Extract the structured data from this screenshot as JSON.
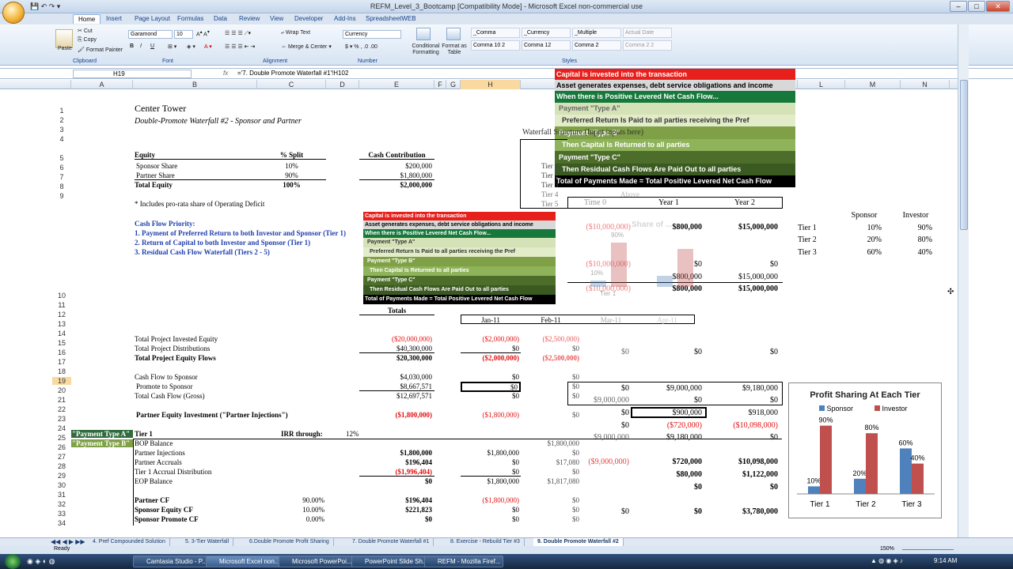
{
  "app": {
    "title": "REFM_Level_3_Bootcamp [Compatibility Mode] - Microsoft Excel non-commercial use"
  },
  "ribbon": {
    "tabs": [
      "Home",
      "Insert",
      "Page Layout",
      "Formulas",
      "Data",
      "Review",
      "View",
      "Developer",
      "Add-Ins",
      "SpreadsheetWEB"
    ],
    "clipboard": {
      "paste": "Paste",
      "cut": "Cut",
      "copy": "Copy",
      "format_painter": "Format Painter",
      "label": "Clipboard"
    },
    "font": {
      "name": "Garamond",
      "size": "10",
      "label": "Font"
    },
    "alignment": {
      "wrap": "Wrap Text",
      "merge": "Merge & Center",
      "label": "Alignment"
    },
    "number": {
      "format": "Currency",
      "label": "Number"
    },
    "styles": {
      "conditional": "Conditional Formatting",
      "table": "Format as Table",
      "boxes": [
        "_Comma",
        "_Currency",
        "_Multiple",
        "Actual Date",
        "Comma 10 2",
        "Comma 12",
        "Comma 2",
        "Comma 2 2"
      ],
      "label": "Styles"
    }
  },
  "formula_bar": {
    "name_box": "H19",
    "fx": "fx",
    "formula": "='7. Double Promote Waterfall #1'!H102"
  },
  "columns": [
    "A",
    "B",
    "C",
    "D",
    "E",
    "F",
    "G",
    "H",
    "I",
    "J",
    "K",
    "L",
    "M",
    "N"
  ],
  "rows": [
    "1",
    "2",
    "3",
    "4",
    "5",
    "6",
    "7",
    "8",
    "9",
    "10",
    "11",
    "12",
    "13",
    "14",
    "15",
    "16",
    "17",
    "18",
    "19",
    "20",
    "21",
    "22",
    "23",
    "24",
    "25",
    "26",
    "27",
    "28",
    "29",
    "30",
    "31",
    "32",
    "33",
    "34"
  ],
  "sheet": {
    "title": "Center Tower",
    "subtitle": "Double-Promote Waterfall #2 - Sponsor and Partner",
    "equity_headers": [
      "Equity",
      "% Split",
      "Cash Contribution"
    ],
    "equity_rows": [
      [
        "Sponsor Share",
        "10%",
        "$200,000"
      ],
      [
        "Partner Share",
        "90%",
        "$1,800,000"
      ],
      [
        "Total  Equity",
        "100%",
        "$2,000,000"
      ]
    ],
    "note": "* Includes pro-rata share of Operating Deficit",
    "priority_title": "Cash Flow Priority:",
    "priority_items": [
      "1. Payment of Preferred Return to both Investor and Sponsor (Tier 1)",
      "2. Return of Capital to both Investor and Sponsor (Tier 1)",
      "3. Residual Cash Flow Waterfall (Tiers 2 - 5)"
    ],
    "waterfall_label": "Waterfall Structure (Input inputs here)",
    "tiers": [
      "Tier 1",
      "Tier 2",
      "Tier 3",
      "Tier 4",
      "Tier 5"
    ],
    "above": "Above",
    "year_headers": [
      "Time 0",
      "Year 1",
      "Year 2"
    ],
    "totals_label": "Totals",
    "months": [
      "Jan-11",
      "Feb-11",
      "Mar-11",
      "Apr-11"
    ],
    "row_labels": {
      "r14": "Total Project Invested Equity",
      "r15": "Total Project Distributions",
      "r16": "Total Project Equity Flows",
      "r18": "Cash Flow to Sponsor",
      "r19": "Promote to Sponsor",
      "r20": "Total  Cash Flow (Gross)",
      "r22": "Partner Equity  Investment (\"Partner Injections\")",
      "r24a": "\"Payment Type A\"",
      "r24b": "Tier 1",
      "r24c": "IRR through:",
      "r24d": "12%",
      "r25a": "\"Payment Type B\"",
      "r25b": "BOP Balance",
      "r26": "Partner Injections",
      "r27": "Partner Accruals",
      "r28": "Tier 1 Accrual Distribution",
      "r29": "EOP Balance",
      "r31": "Partner CF",
      "r32": "Sponsor Equity CF",
      "r33": "Sponsor Promote CF"
    },
    "totals": {
      "r14": "($20,000,000)",
      "r15": "$40,300,000",
      "r16": "$20,300,000",
      "r18": "$4,030,000",
      "r19": "$8,667,571",
      "r20": "$12,697,571",
      "r22": "($1,800,000)",
      "r25": "",
      "r26": "$1,800,000",
      "r27": "$196,404",
      "r28": "($1,996,404)",
      "r29": "$0",
      "r31": "$196,404",
      "r32": "$221,823",
      "r33": "$0"
    },
    "pcts": {
      "r31": "90.00%",
      "r32": "10.00%",
      "r33": "0.00%"
    },
    "colH": {
      "r14": "($2,000,000)",
      "r15": "$0",
      "r16": "($2,000,000)",
      "r18": "$0",
      "r19": "$0",
      "r20": "$0",
      "r22": "($1,800,000)",
      "r25": "",
      "r26": "$1,800,000",
      "r27": "$0",
      "r28": "$0",
      "r29": "$1,800,000",
      "r31": "($1,800,000)",
      "r32": "$0",
      "r33": "$0"
    },
    "colI": {
      "r14": "($2,500,000)",
      "r15": "$0",
      "r16": "($2,500,000)",
      "r18": "$0",
      "r19": "$0",
      "r20": "$0",
      "r22": "$0",
      "r25": "$1,800,000",
      "r26": "$0",
      "r27": "$17,080",
      "r28": "$0",
      "r29": "$1,817,080",
      "r31": "$0",
      "r32": "$0",
      "r33": "$0"
    },
    "split_headers": [
      "Sponsor",
      "Investor"
    ],
    "splits": [
      [
        "Tier 1",
        "10%",
        "90%"
      ],
      [
        "Tier 2",
        "20%",
        "80%"
      ],
      [
        "Tier 3",
        "60%",
        "40%"
      ]
    ],
    "calc_top": [
      [
        "($10,000,000)",
        "$800,000",
        "$15,000,000"
      ],
      [
        "($10,000,000)",
        "$0",
        "$0"
      ],
      [
        "",
        "$800,000",
        "$15,000,000"
      ],
      [
        "($10,000,000)",
        "$800,000",
        "$15,000,000"
      ]
    ],
    "calc_mid": [
      [
        "$0",
        "$0"
      ],
      [
        "$9,000,000",
        "$9,180,000"
      ],
      [
        "$0",
        "$0"
      ],
      [
        "$900,000",
        "$918,000"
      ],
      [
        "($720,000)",
        "($10,098,000)"
      ],
      [
        "$9,180,000",
        "$0"
      ],
      [
        "$720,000",
        "$10,098,000"
      ],
      [
        "$80,000",
        "$1,122,000"
      ],
      [
        "$0",
        "$0"
      ],
      [
        "$0",
        "$3,780,000"
      ]
    ],
    "calc_mid_left": [
      "$0",
      "$9,000,000",
      "$0",
      "$0",
      "$9,000,000",
      "($9,000,000)",
      "$0",
      "$0"
    ]
  },
  "popup_large": {
    "bars": [
      "Capital is invested into the transaction",
      "Asset generates expenses, debt service obligations and income",
      "When there is Positive Levered Net Cash Flow...",
      "Payment \"Type A\"",
      "Preferred Return Is Paid to all parties receiving the Pref",
      "Payment \"Type B\"",
      "Then Capital Is Returned to all parties",
      "Payment \"Type C\"",
      "Then Residual Cash Flows Are Paid Out to all parties",
      "Total of Payments Made = Total Positive Levered Net Cash Flow"
    ],
    "colors": [
      "#e8201c",
      "#d8d8d8",
      "#16793b",
      "#d5e2b8",
      "#e2ecc9",
      "#7fa046",
      "#8fb35a",
      "#4d6e2a",
      "#3b5a22",
      "#000000"
    ]
  },
  "popup_small": {
    "bars": [
      "Capital is invested into the transaction",
      "Asset generates expenses, debt service obligations and income",
      "When there is Positive Levered Net Cash Flow...",
      "Payment \"Type A\"",
      "Preferred Return Is Paid to all parties receiving the Pref",
      "Payment \"Type B\"",
      "Then Capital Is Returned to all parties",
      "Payment \"Type C\"",
      "Then Residual Cash Flows Are Paid Out to all parties",
      "Total of Payments Made = Total Positive Levered Net Cash Flow"
    ]
  },
  "ghost_chart": {
    "title": "Share of ...",
    "labels": [
      "90%",
      "10%"
    ],
    "tier": "Tier 1"
  },
  "chart_data": {
    "type": "bar",
    "title": "Profit Sharing At Each Tier",
    "categories": [
      "Tier 1",
      "Tier 2",
      "Tier 3"
    ],
    "series": [
      {
        "name": "Sponsor",
        "values": [
          10,
          20,
          60
        ],
        "color": "#4f81bd"
      },
      {
        "name": "Investor",
        "values": [
          90,
          80,
          40
        ],
        "color": "#c0504d"
      }
    ],
    "data_labels": [
      [
        "10%",
        "20%",
        "60%"
      ],
      [
        "90%",
        "80%",
        "40%"
      ]
    ],
    "ylim": [
      0,
      100
    ]
  },
  "sheet_tabs": [
    "4. Pref Compounded Solution",
    "5. 3-Tier Waterfall",
    "6.Double Promote Profit Sharing",
    "7. Double Promote Waterfall #1",
    "8. Exercise - Rebuild Tier #3",
    "9. Double Promote Waterfall #2"
  ],
  "status": {
    "ready": "Ready",
    "zoom": "150%"
  },
  "taskbar": {
    "items": [
      "Camtasia Studio - P...",
      "Microsoft Excel non...",
      "Microsoft PowerPoi...",
      "PowerPoint Slide Sh...",
      "REFM - Mozilla Firef..."
    ],
    "time": "9:14 AM"
  }
}
